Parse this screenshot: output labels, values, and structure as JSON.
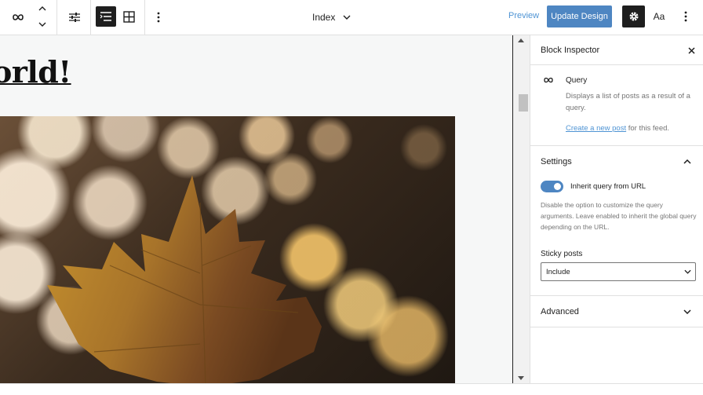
{
  "toolbar": {
    "icons": [
      "loop-icon",
      "chevron-up-icon",
      "chevron-down-icon",
      "settings-sliders-icon",
      "list-view-icon",
      "grid-icon",
      "more-vertical-icon",
      "cog-icon"
    ],
    "document_title": "Index",
    "preview_label": "Preview",
    "update_label": "Update Design",
    "styles_label": "Aa"
  },
  "canvas": {
    "post_title": "orld!",
    "image_description": "maple leaf with bokeh lights"
  },
  "sidebar": {
    "title": "Block Inspector",
    "block": {
      "name": "Query",
      "description": "Displays a list of posts as a result of a query.",
      "create_link": "Create a new post",
      "create_suffix": " for this feed."
    },
    "settings": {
      "title": "Settings",
      "toggle_label": "Inherit query from URL",
      "toggle_on": true,
      "help": "Disable the option to customize the query arguments. Leave enabled to inherit the global query depending on the URL.",
      "sticky_label": "Sticky posts",
      "sticky_value": "Include"
    },
    "advanced": {
      "title": "Advanced"
    }
  },
  "colors": {
    "accent": "#4e86c2",
    "link": "#4f94d4",
    "dark": "#1e1e1e"
  }
}
